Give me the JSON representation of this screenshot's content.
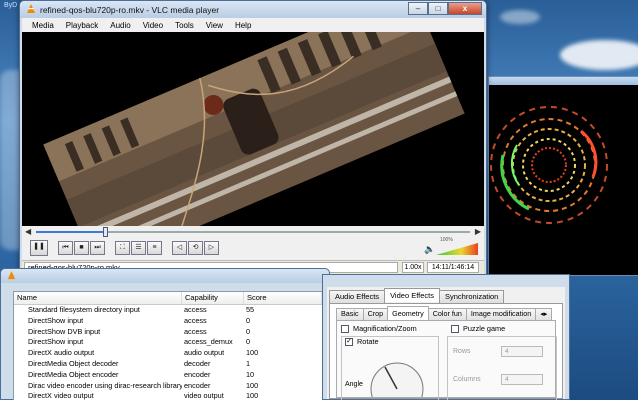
{
  "desktop": {
    "corner_text": "ByD"
  },
  "vlc": {
    "title": "refined-qos-blu720p-ro.mkv - VLC media player",
    "menu": [
      "Media",
      "Playback",
      "Audio",
      "Video",
      "Tools",
      "View",
      "Help"
    ],
    "seek_progress": 0.16,
    "volume_label": "100%",
    "status_file": "refined-qos-blu720p-ro.mkv",
    "status_speed": "1.00x",
    "status_time": "14:11/1:46:14",
    "window_buttons": {
      "minimize": "–",
      "maximize": "□",
      "close": "x"
    }
  },
  "plugins": {
    "headers": [
      "Name",
      "Capability",
      "Score"
    ],
    "rows": [
      [
        "Standard filesystem directory input",
        "access",
        "55"
      ],
      [
        "DirectShow input",
        "access",
        "0"
      ],
      [
        "DirectShow DVB input",
        "access",
        "0"
      ],
      [
        "DirectShow input",
        "access_demux",
        "0"
      ],
      [
        "DirectX audio output",
        "audio output",
        "100"
      ],
      [
        "DirectMedia Object decoder",
        "decoder",
        "1"
      ],
      [
        "DirectMedia Object encoder",
        "encoder",
        "10"
      ],
      [
        "Dirac video encoder using dirac-research library",
        "encoder",
        "100"
      ],
      [
        "DirectX video output",
        "video output",
        "100"
      ]
    ]
  },
  "effects": {
    "tabs": [
      "Audio Effects",
      "Video Effects",
      "Synchronization"
    ],
    "subtabs": [
      "Basic",
      "Crop",
      "Geometry",
      "Color fun",
      "Image modification"
    ],
    "magnification": "Magnification/Zoom",
    "rotate": "Rotate",
    "angle": "Angle",
    "puzzle": "Puzzle game",
    "rows_label": "Rows",
    "rows_value": "4",
    "columns_label": "Columns",
    "columns_value": "4"
  }
}
